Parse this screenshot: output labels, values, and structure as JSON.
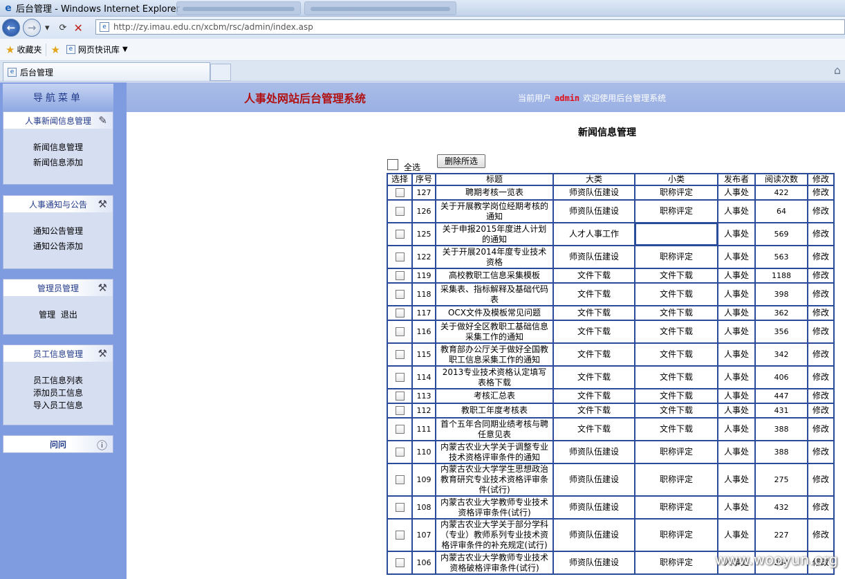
{
  "browser": {
    "window_title": "后台管理 - Windows Internet Explorer",
    "url": "http://zy.imau.edu.cn/xcbm/rsc/admin/index.asp",
    "favorites_label": "收藏夹",
    "web_slice_label": "网页快讯库",
    "tab_title": "后台管理"
  },
  "sidebar": {
    "nav_title": "导航菜单",
    "panels": [
      {
        "title": "人事新闻信息管理",
        "items": [
          "新闻信息管理",
          "新闻信息添加"
        ]
      },
      {
        "title": "人事通知与公告",
        "items": [
          "通知公告管理",
          "通知公告添加"
        ]
      },
      {
        "title": "管理员管理",
        "items": [
          "管理",
          "退出"
        ]
      },
      {
        "title": "员工信息管理",
        "items": [
          "员工信息列表",
          "添加员工信息",
          "导入员工信息"
        ]
      },
      {
        "title": "问问",
        "items": []
      }
    ]
  },
  "header": {
    "system_name": "人事处网站后台管理系统",
    "current_user_label": "当前用户",
    "username": "admin",
    "welcome": "欢迎使用后台管理系统"
  },
  "main": {
    "title": "新闻信息管理",
    "select_all_label": "全选",
    "delete_button": "删除所选",
    "columns": [
      "选择",
      "序号",
      "标题",
      "大类",
      "小类",
      "发布者",
      "阅读次数",
      "修改"
    ],
    "rows": [
      {
        "id": "127",
        "title": "聘期考核一览表",
        "category": "师资队伍建设",
        "subcategory": "职称评定",
        "publisher": "人事处",
        "reads": "422",
        "edit": "修改"
      },
      {
        "id": "126",
        "title": "关于开展教学岗位经期考核的通知",
        "category": "师资队伍建设",
        "subcategory": "职称评定",
        "publisher": "人事处",
        "reads": "64",
        "edit": "修改"
      },
      {
        "id": "125",
        "title": "关于申报2015年度进人计划的通知",
        "category": "人才人事工作",
        "subcategory": "",
        "publisher": "人事处",
        "reads": "569",
        "edit": "修改"
      },
      {
        "id": "122",
        "title": "关于开展2014年度专业技术资格",
        "category": "师资队伍建设",
        "subcategory": "职称评定",
        "publisher": "人事处",
        "reads": "563",
        "edit": "修改"
      },
      {
        "id": "119",
        "title": "高校教职工信息采集模板",
        "category": "文件下载",
        "subcategory": "文件下载",
        "publisher": "人事处",
        "reads": "1188",
        "edit": "修改"
      },
      {
        "id": "118",
        "title": "采集表、指标解释及基础代码表",
        "category": "文件下载",
        "subcategory": "文件下载",
        "publisher": "人事处",
        "reads": "398",
        "edit": "修改"
      },
      {
        "id": "117",
        "title": "OCX文件及模板常见问题",
        "category": "文件下载",
        "subcategory": "文件下载",
        "publisher": "人事处",
        "reads": "362",
        "edit": "修改"
      },
      {
        "id": "116",
        "title": "关于做好全区教职工基础信息采集工作的通知",
        "category": "文件下载",
        "subcategory": "文件下载",
        "publisher": "人事处",
        "reads": "356",
        "edit": "修改"
      },
      {
        "id": "115",
        "title": "教育部办公厅关于做好全国教职工信息采集工作的通知",
        "category": "文件下载",
        "subcategory": "文件下载",
        "publisher": "人事处",
        "reads": "342",
        "edit": "修改"
      },
      {
        "id": "114",
        "title": "2013专业技术资格认定填写表格下载",
        "category": "文件下载",
        "subcategory": "文件下载",
        "publisher": "人事处",
        "reads": "406",
        "edit": "修改"
      },
      {
        "id": "113",
        "title": "考核汇总表",
        "category": "文件下载",
        "subcategory": "文件下载",
        "publisher": "人事处",
        "reads": "447",
        "edit": "修改"
      },
      {
        "id": "112",
        "title": "教职工年度考核表",
        "category": "文件下载",
        "subcategory": "文件下载",
        "publisher": "人事处",
        "reads": "431",
        "edit": "修改"
      },
      {
        "id": "111",
        "title": "首个五年合同期业绩考核与聘任意见表",
        "category": "文件下载",
        "subcategory": "文件下载",
        "publisher": "人事处",
        "reads": "388",
        "edit": "修改"
      },
      {
        "id": "110",
        "title": "内蒙古农业大学关于调整专业技术资格评审条件的通知",
        "category": "师资队伍建设",
        "subcategory": "职称评定",
        "publisher": "人事处",
        "reads": "388",
        "edit": "修改"
      },
      {
        "id": "109",
        "title": "内蒙古农业大学学生思想政治教育研究专业技术资格评审条件(试行)",
        "category": "师资队伍建设",
        "subcategory": "职称评定",
        "publisher": "人事处",
        "reads": "275",
        "edit": "修改"
      },
      {
        "id": "108",
        "title": "内蒙古农业大学教师专业技术资格评审条件(试行)",
        "category": "师资队伍建设",
        "subcategory": "职称评定",
        "publisher": "人事处",
        "reads": "432",
        "edit": "修改"
      },
      {
        "id": "107",
        "title": "内蒙古农业大学关于部分学科（专业）教师系列专业技术资格评审条件的补充规定(试行)",
        "category": "师资队伍建设",
        "subcategory": "职称评定",
        "publisher": "人事处",
        "reads": "227",
        "edit": "修改"
      },
      {
        "id": "106",
        "title": "内蒙古农业大学教师专业技术资格破格评审条件(试行)",
        "category": "师资队伍建设",
        "subcategory": "职称评定",
        "publisher": "人事处",
        "reads": "264",
        "edit": "修改"
      }
    ]
  },
  "watermark": "www.wooyun.org"
}
